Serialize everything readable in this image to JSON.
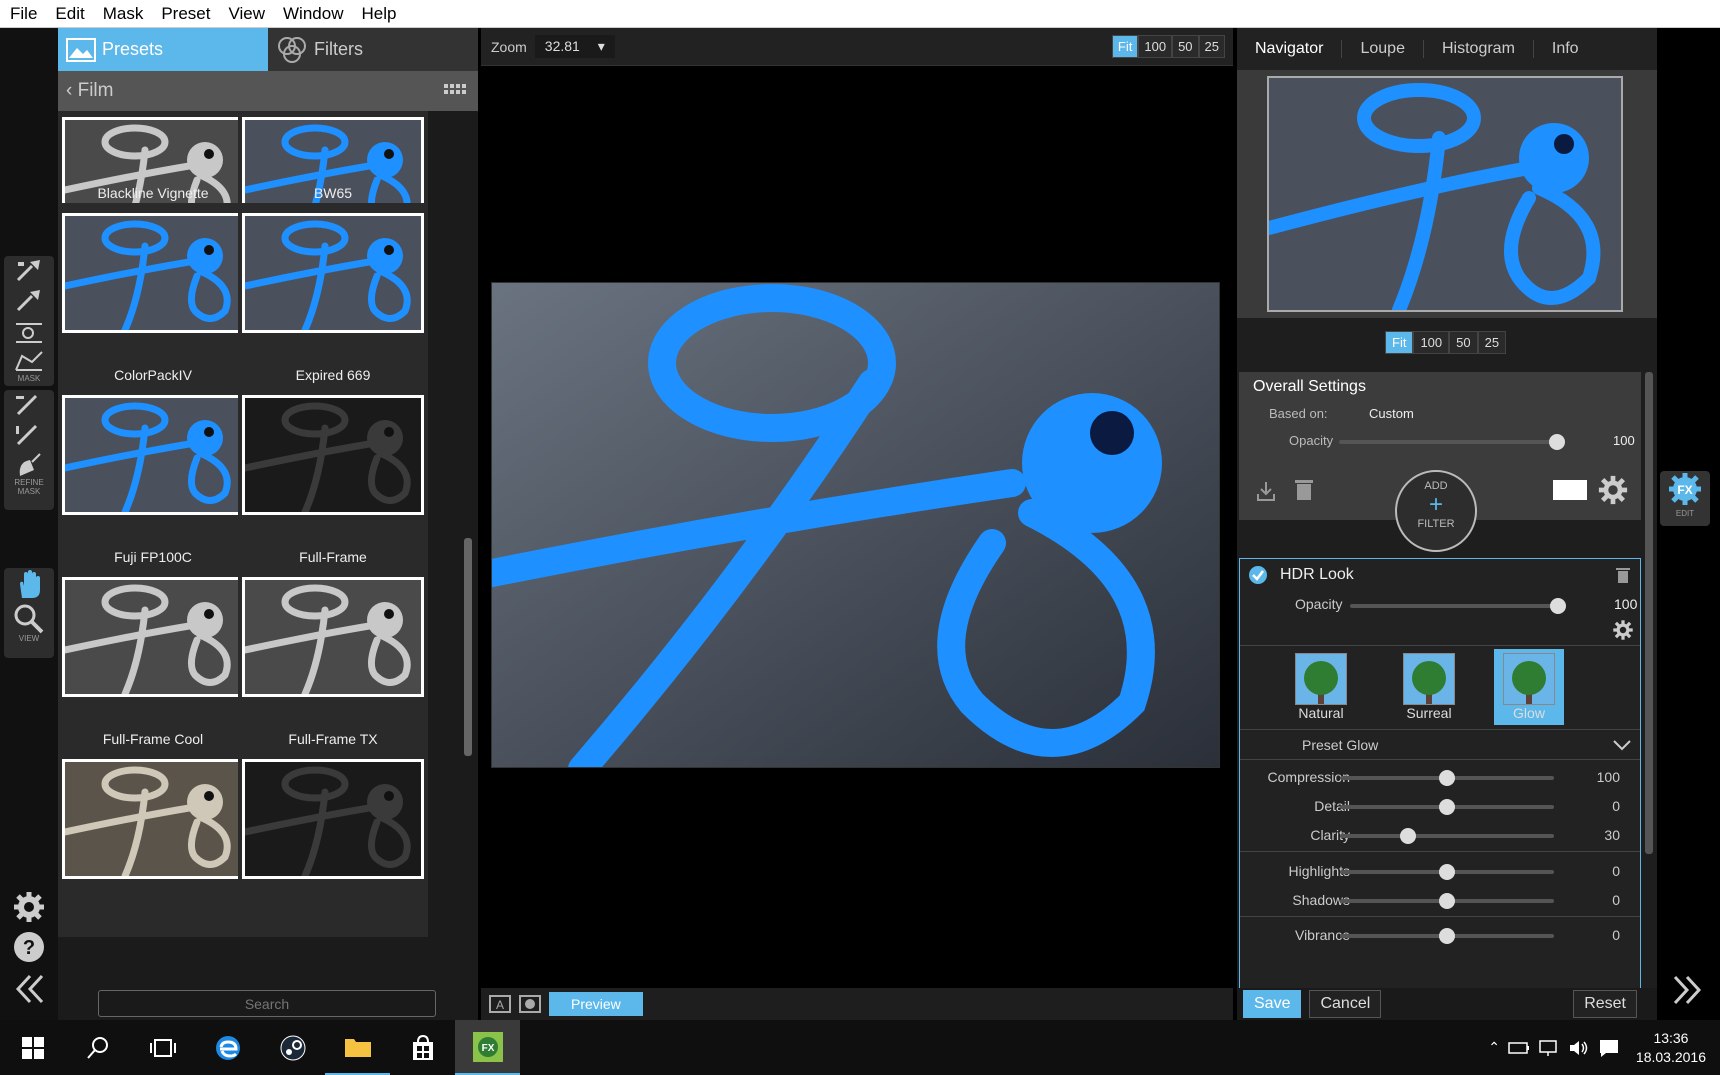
{
  "menubar": {
    "items": [
      "File",
      "Edit",
      "Mask",
      "Preset",
      "View",
      "Window",
      "Help"
    ]
  },
  "toolstrip": {
    "mask_label": "MASK",
    "refine_label": "REFINE MASK",
    "view_label": "VIEW"
  },
  "left": {
    "tab_presets": "Presets",
    "tab_filters": "Filters",
    "breadcrumb": "Film",
    "presets": [
      {
        "name": "Blackline Vignette",
        "style": "gray"
      },
      {
        "name": "BW65",
        "style": "blue"
      },
      {
        "name": "ColorPackIV",
        "style": "blue"
      },
      {
        "name": "Expired 669",
        "style": "blue"
      },
      {
        "name": "Fuji FP100C",
        "style": "blue"
      },
      {
        "name": "Full-Frame",
        "style": "dark"
      },
      {
        "name": "Full-Frame Cool",
        "style": "gray"
      },
      {
        "name": "Full-Frame TX",
        "style": "gray"
      },
      {
        "name": "",
        "style": "sepia"
      },
      {
        "name": "",
        "style": "dark"
      }
    ],
    "search_placeholder": "Search"
  },
  "center": {
    "zoom_label": "Zoom",
    "zoom_value": "32.81",
    "zoom_buttons": [
      "Fit",
      "100",
      "50",
      "25"
    ],
    "preview_label": "Preview"
  },
  "right": {
    "nav_tabs": [
      "Navigator",
      "Loupe",
      "Histogram",
      "Info"
    ],
    "nav_zoom_buttons": [
      "Fit",
      "100",
      "50",
      "25"
    ],
    "overall": {
      "title": "Overall Settings",
      "based_on_label": "Based on:",
      "based_on_value": "Custom",
      "opacity_label": "Opacity",
      "opacity_value": "100",
      "add_filter_top": "ADD",
      "add_filter_bottom": "FILTER"
    },
    "hdr": {
      "title": "HDR Look",
      "opacity_label": "Opacity",
      "opacity_value": "100",
      "styles": [
        "Natural",
        "Surreal",
        "Glow"
      ],
      "selected_style": "Glow",
      "preset_label": "Preset Glow",
      "sliders": [
        {
          "label": "Compression",
          "value": "100",
          "pos": 0.5
        },
        {
          "label": "Detail",
          "value": "0",
          "pos": 0.5
        },
        {
          "label": "Clarity",
          "value": "30",
          "pos": 0.32
        },
        {
          "label": "Highlights",
          "value": "0",
          "pos": 0.5
        },
        {
          "label": "Shadows",
          "value": "0",
          "pos": 0.5
        },
        {
          "label": "Vibrance",
          "value": "0",
          "pos": 0.5
        }
      ]
    },
    "buttons": {
      "save": "Save",
      "cancel": "Cancel",
      "reset": "Reset"
    }
  },
  "edge": {
    "fx_label": "EDIT"
  },
  "taskbar": {
    "time": "13:36",
    "date": "18.03.2016"
  },
  "colors": {
    "accent": "#5cb8ea",
    "subject_blue": "#1e90ff"
  }
}
